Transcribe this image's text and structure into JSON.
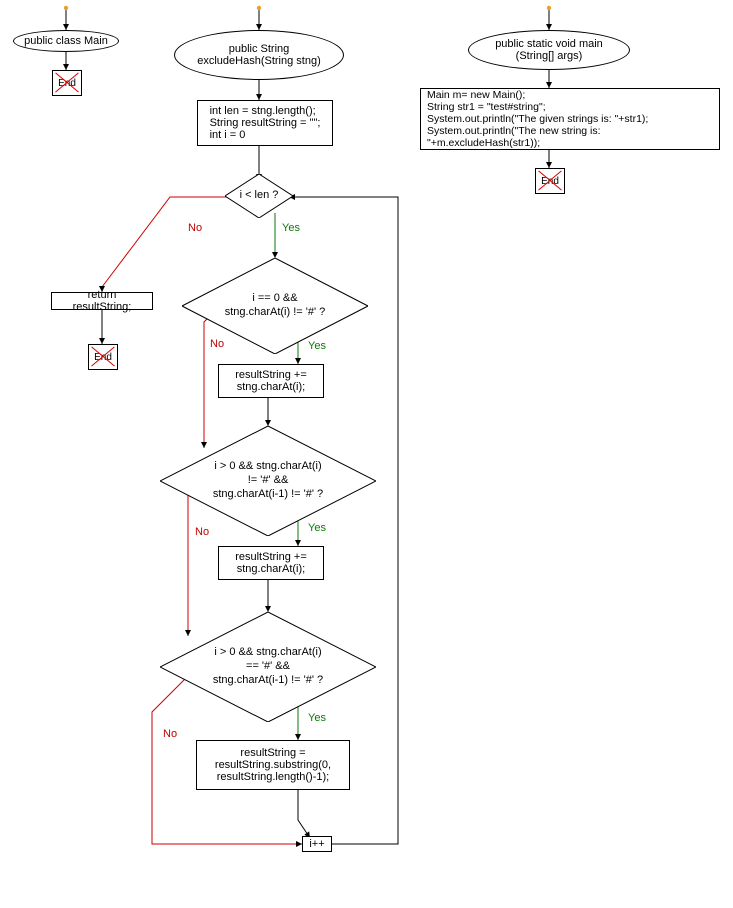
{
  "labels": {
    "yes": "Yes",
    "no": "No",
    "end": "End"
  },
  "flow1": {
    "class_decl": "public class Main"
  },
  "flow2": {
    "method_decl": "public String\nexcludeHash(String stng)",
    "init": "int len = stng.length();\nString resultString = \"\";\nint i = 0",
    "loop_cond": "i < len ?",
    "return_stmt": "return resultString;",
    "cond1": "i == 0 &&\nstng.charAt(i) != '#' ?",
    "stmt1": "resultString +=\nstng.charAt(i);",
    "cond2": "i > 0 && stng.charAt(i)\n!= '#' &&\nstng.charAt(i-1) != '#' ?",
    "stmt2": "resultString +=\nstng.charAt(i);",
    "cond3": "i > 0 && stng.charAt(i)\n== '#' &&\nstng.charAt(i-1) != '#' ?",
    "stmt3": "resultString =\nresultString.substring(0,\nresultString.length()-1);",
    "increment": "i++"
  },
  "flow3": {
    "method_decl": "public static void main\n(String[] args)",
    "body": "Main m= new Main();\nString str1 = \"test#string\";\nSystem.out.println(\"The given strings is: \"+str1);\nSystem.out.println(\"The new string is: \"+m.excludeHash(str1));"
  }
}
